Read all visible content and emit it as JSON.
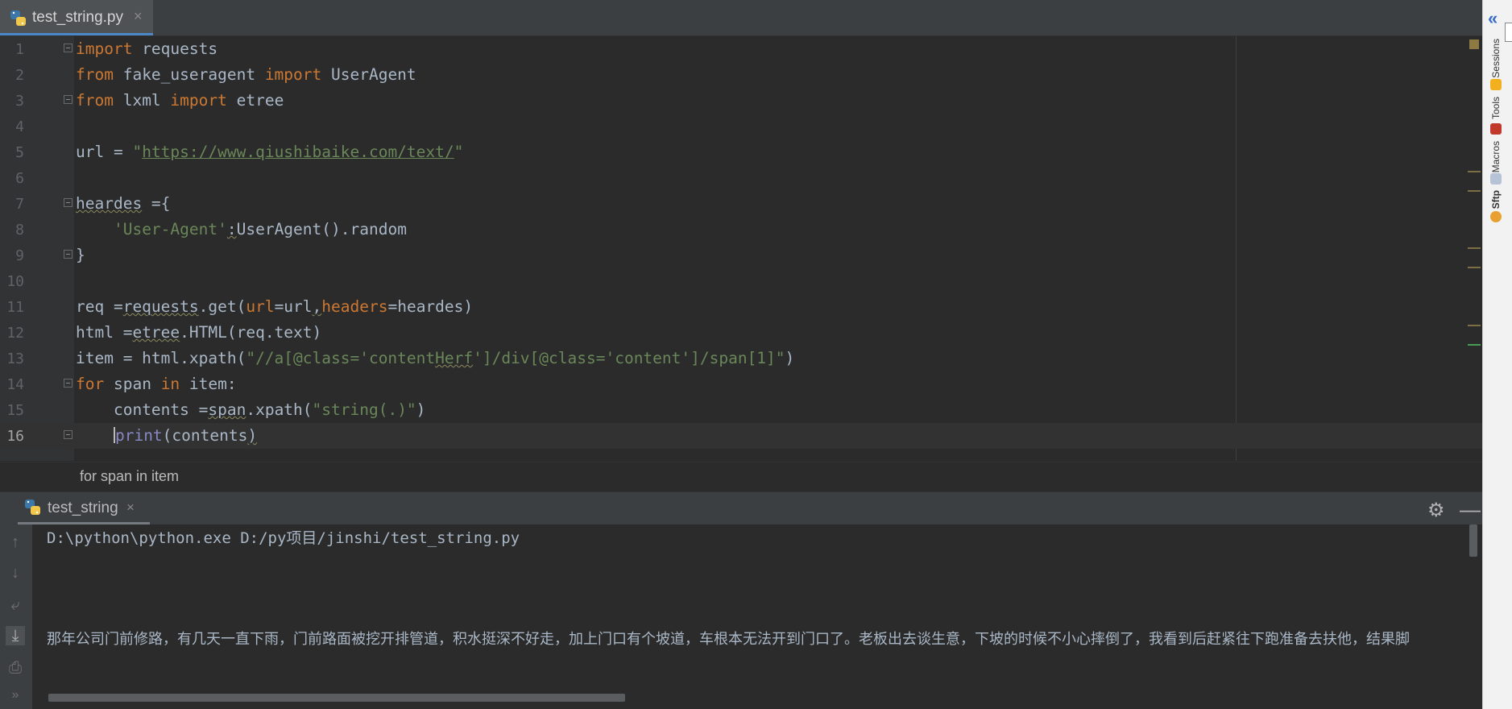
{
  "tab": {
    "filename": "test_string.py",
    "close": "×"
  },
  "code_lines": [
    {
      "n": "1"
    },
    {
      "n": "2"
    },
    {
      "n": "3"
    },
    {
      "n": "4"
    },
    {
      "n": "5"
    },
    {
      "n": "6"
    },
    {
      "n": "7"
    },
    {
      "n": "8"
    },
    {
      "n": "9"
    },
    {
      "n": "10"
    },
    {
      "n": "11"
    },
    {
      "n": "12"
    },
    {
      "n": "13"
    },
    {
      "n": "14"
    },
    {
      "n": "15"
    },
    {
      "n": "16"
    }
  ],
  "code": {
    "l1_kw": "import",
    "l1_rest": " requests",
    "l2_kw1": "from",
    "l2_mod": " fake_useragent ",
    "l2_kw2": "import",
    "l2_name": " UserAgent",
    "l3_kw1": "from",
    "l3_mod": " lxml ",
    "l3_kw2": "import",
    "l3_name": " etree",
    "l5_var": "url = ",
    "l5_q1": "\"",
    "l5_url": "https://www.qiushibaike.com/text/",
    "l5_q2": "\"",
    "l7_var": "heardes",
    "l7_rest": " ={",
    "l8_indent": "    ",
    "l8_str": "'User-Agent'",
    "l8_colon": ":",
    "l8_rest": "UserAgent().random",
    "l9": "}",
    "l11_a": "req =",
    "l11_b": "requests",
    "l11_c": ".get(",
    "l11_p1": "url",
    "l11_d": "=url",
    "l11_comma": ",",
    "l11_p2": "headers",
    "l11_e": "=heardes)",
    "l12_a": "html =",
    "l12_b": "etree",
    "l12_c": ".HTML(req.text)",
    "l13_a": "item = html.xpath(",
    "l13_s1": "\"//a[@class='content",
    "l13_s2": "Herf",
    "l13_s3": "']/div[@class='content']/span[1]\"",
    "l13_b": ")",
    "l14_kw1": "for",
    "l14_a": " span ",
    "l14_kw2": "in",
    "l14_b": " item:",
    "l15_indent": "    ",
    "l15_a": "contents =",
    "l15_b": "span",
    "l15_c": ".xpath(",
    "l15_s": "\"string(.)\"",
    "l15_d": ")",
    "l16_indent": "    ",
    "l16_fn": "print",
    "l16_a": "(contents",
    "l16_b": ")"
  },
  "breadcrumb": "for span in item",
  "run": {
    "tab_label": "test_string",
    "close": "×",
    "command": "D:\\python\\python.exe D:/py项目/jinshi/test_string.py",
    "output": "那年公司门前修路，有几天一直下雨，门前路面被挖开排管道，积水挺深不好走，加上门口有个坡道，车根本无法开到门口了。老板出去谈生意，下坡的时候不小心摔倒了，我看到后赶紧往下跑准备去扶他，结果脚"
  },
  "right_panel": {
    "nav": "«",
    "labels": [
      "Sessions",
      "Tools",
      "Macros",
      "Sftp"
    ]
  }
}
